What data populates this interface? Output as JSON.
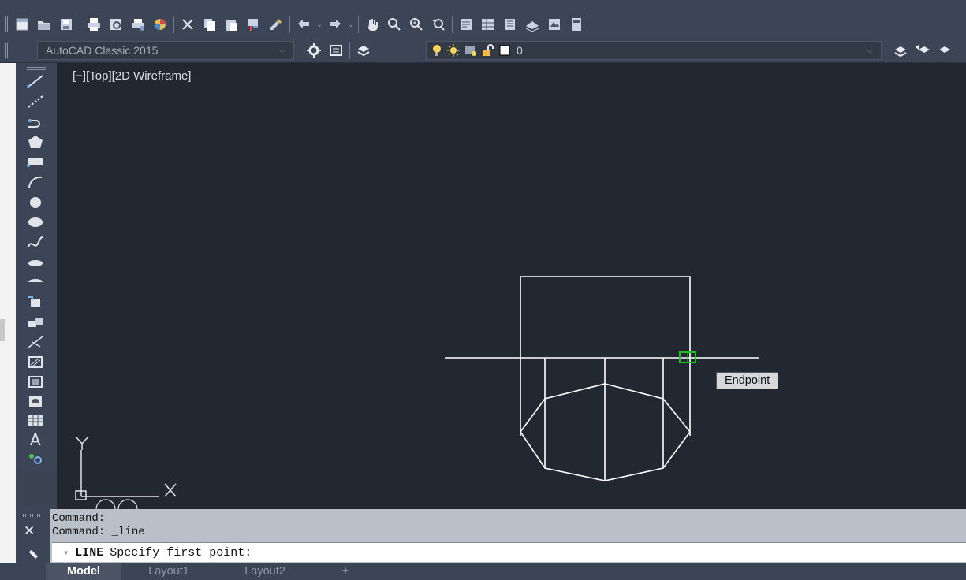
{
  "toolbar": {
    "workspace": "AutoCAD Classic 2015",
    "layer_value": "0"
  },
  "viewport": {
    "label": "[−][Top][2D Wireframe]",
    "tooltip": "Endpoint",
    "ucs_y": "Y",
    "ucs_x": "X"
  },
  "command": {
    "history": [
      "Command:",
      "Command: _line"
    ],
    "prompt_keyword": "LINE",
    "prompt_text": "Specify first point:"
  },
  "tabs": [
    "Model",
    "Layout1",
    "Layout2"
  ],
  "colors": {
    "background": "#212831",
    "toolbar": "#3c4555",
    "linework": "#ffffff",
    "osnap_marker": "#20c020"
  }
}
